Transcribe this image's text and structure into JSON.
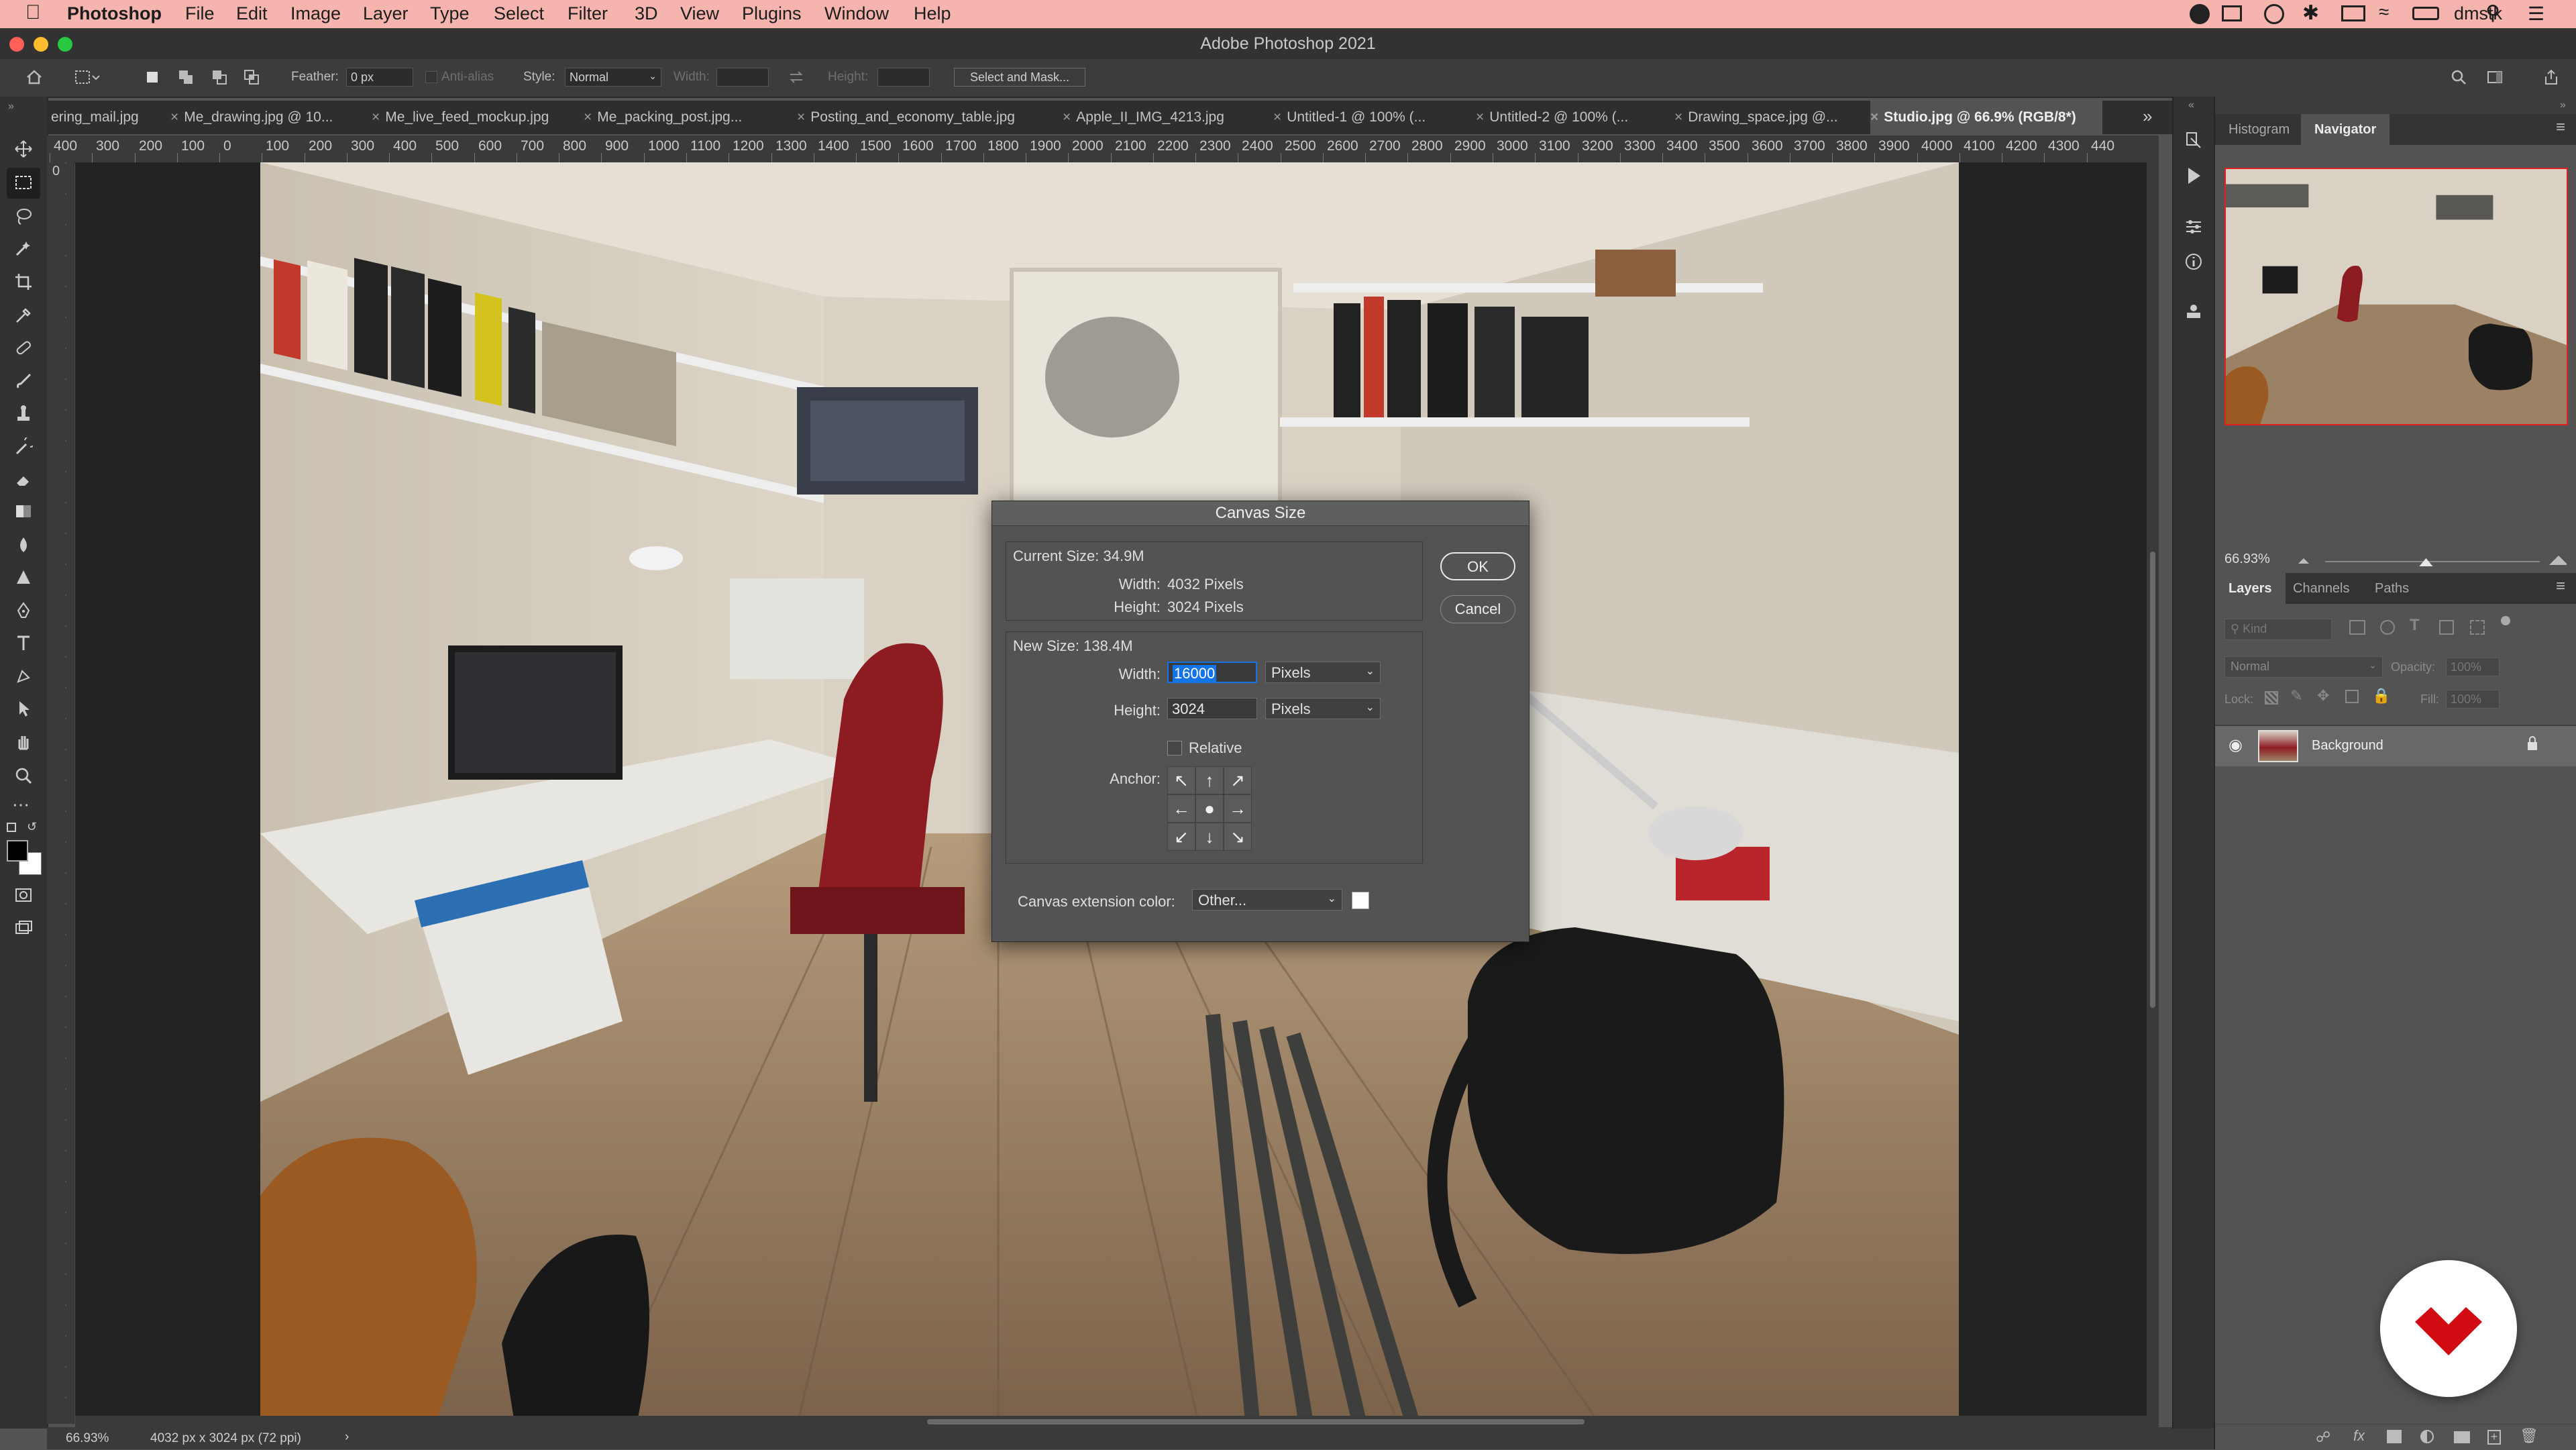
{
  "colors": {
    "menubar_bg": "#f5b5ae",
    "panel_bg": "#3c3c3c",
    "canvas_bg": "#535353",
    "dialog_bg": "#535353",
    "accent_blue": "#1473e6",
    "logo_red": "#d20a11",
    "traffic_close": "#ff5f57",
    "traffic_min": "#febc2e",
    "traffic_max": "#28c840"
  },
  "menubar": {
    "app": "Photoshop",
    "items": [
      "File",
      "Edit",
      "Image",
      "Layer",
      "Type",
      "Select",
      "Filter",
      "3D",
      "View",
      "Plugins",
      "Window",
      "Help"
    ],
    "user": "dmstk"
  },
  "window": {
    "title": "Adobe Photoshop 2021"
  },
  "options_bar": {
    "feather_label": "Feather:",
    "feather_value": "0 px",
    "antialias_label": "Anti-alias",
    "style_label": "Style:",
    "style_value": "Normal",
    "width_label": "Width:",
    "height_label": "Height:",
    "select_mask_label": "Select and Mask..."
  },
  "tabs": [
    "ering_mail.jpg",
    "Me_drawing.jpg @ 10...",
    "Me_live_feed_mockup.jpg",
    "Me_packing_post.jpg...",
    "Posting_and_economy_table.jpg",
    "Apple_II_IMG_4213.jpg",
    "Untitled-1 @ 100% (...",
    "Untitled-2 @ 100% (...",
    "Drawing_space.jpg @...",
    "Studio.jpg @ 66.9% (RGB/8*)"
  ],
  "ruler_ticks": [
    "400",
    "300",
    "200",
    "100",
    "0",
    "100",
    "200",
    "300",
    "400",
    "500",
    "600",
    "700",
    "800",
    "900",
    "1000",
    "1100",
    "1200",
    "1300",
    "1400",
    "1500",
    "1600",
    "1700",
    "1800",
    "1900",
    "2000",
    "2100",
    "2200",
    "2300",
    "2400",
    "2500",
    "2600",
    "2700",
    "2800",
    "2900",
    "3000",
    "3100",
    "3200",
    "3300",
    "3400",
    "3500",
    "3600",
    "3700",
    "3800",
    "3900",
    "4000",
    "4100",
    "4200",
    "4300",
    "440"
  ],
  "vruler_zero": "0",
  "status": {
    "zoom": "66.93%",
    "doc_info": "4032 px x 3024 px (72 ppi)",
    "arrow": "›"
  },
  "navigator": {
    "tabs": [
      "Histogram",
      "Navigator"
    ],
    "active_tab": "Navigator",
    "zoom": "66.93%",
    "zoom_slider_level": 0.47
  },
  "layers_panel": {
    "tabs": [
      "Layers",
      "Channels",
      "Paths"
    ],
    "active_tab": "Layers",
    "kind_placeholder": "Kind",
    "blend_mode": "Normal",
    "opacity_label": "Opacity:",
    "opacity_value": "100%",
    "lock_label": "Lock:",
    "fill_label": "Fill:",
    "fill_value": "100%",
    "layers": [
      {
        "name": "Background",
        "visible": true,
        "locked": true
      }
    ]
  },
  "dialog": {
    "title": "Canvas Size",
    "current_size_label": "Current Size: 34.9M",
    "current_width_label": "Width:",
    "current_width_value": "4032 Pixels",
    "current_height_label": "Height:",
    "current_height_value": "3024 Pixels",
    "new_size_label": "New Size: 138.4M",
    "width_label": "Width:",
    "width_value": "16000",
    "width_unit": "Pixels",
    "height_label": "Height:",
    "height_value": "3024",
    "height_unit": "Pixels",
    "relative_label": "Relative",
    "relative_checked": false,
    "anchor_label": "Anchor:",
    "ok_label": "OK",
    "cancel_label": "Cancel",
    "extension_label": "Canvas extension color:",
    "extension_value": "Other...",
    "extension_swatch": "#ffffff"
  }
}
